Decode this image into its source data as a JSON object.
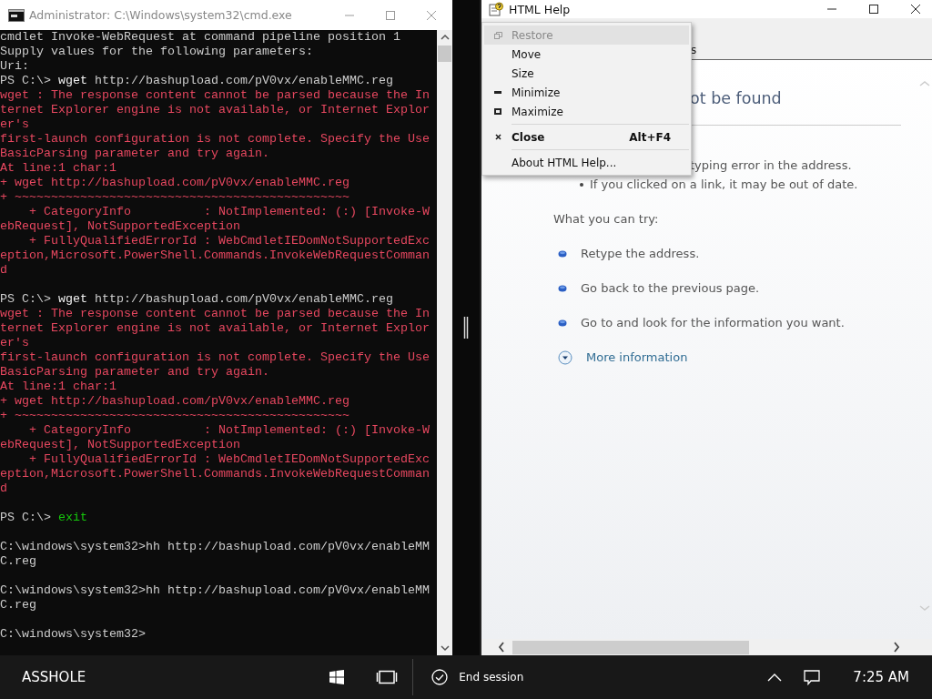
{
  "console_window": {
    "title": "Administrator: C:\\Windows\\system32\\cmd.exe",
    "lines": [
      {
        "kind": "text",
        "segments": [
          {
            "kind": "output",
            "text": "cmdlet Invoke-WebRequest at command pipeline position 1"
          }
        ]
      },
      {
        "kind": "text",
        "segments": [
          {
            "kind": "output",
            "text": "Supply values for the following parameters:"
          }
        ]
      },
      {
        "kind": "text",
        "segments": [
          {
            "kind": "output",
            "text": "Uri:"
          }
        ]
      },
      {
        "kind": "text",
        "segments": [
          {
            "kind": "output",
            "text": "PS C:\\> "
          },
          {
            "kind": "command",
            "text": "wget"
          },
          {
            "kind": "output",
            "text": " http://bashupload.com/pV0vx/enableMMC.reg"
          }
        ]
      },
      {
        "kind": "text",
        "segments": [
          {
            "kind": "error",
            "text": "wget : The response content cannot be parsed because the In"
          }
        ]
      },
      {
        "kind": "text",
        "segments": [
          {
            "kind": "error",
            "text": "ternet Explorer engine is not available, or Internet Explor"
          }
        ]
      },
      {
        "kind": "text",
        "segments": [
          {
            "kind": "error",
            "text": "er's"
          }
        ]
      },
      {
        "kind": "text",
        "segments": [
          {
            "kind": "error",
            "text": "first-launch configuration is not complete. Specify the Use"
          }
        ]
      },
      {
        "kind": "text",
        "segments": [
          {
            "kind": "error",
            "text": "BasicParsing parameter and try again."
          }
        ]
      },
      {
        "kind": "text",
        "segments": [
          {
            "kind": "error",
            "text": "At line:1 char:1"
          }
        ]
      },
      {
        "kind": "text",
        "segments": [
          {
            "kind": "error",
            "text": "+ wget http://bashupload.com/pV0vx/enableMMC.reg"
          }
        ]
      },
      {
        "kind": "text",
        "segments": [
          {
            "kind": "error",
            "text": "+ ~~~~~~~~~~~~~~~~~~~~~~~~~~~~~~~~~~~~~~~~~~~~~~"
          }
        ]
      },
      {
        "kind": "text",
        "segments": [
          {
            "kind": "error",
            "text": "    + CategoryInfo          : NotImplemented: (:) [Invoke-W"
          }
        ]
      },
      {
        "kind": "text",
        "segments": [
          {
            "kind": "error",
            "text": "ebRequest], NotSupportedException"
          }
        ]
      },
      {
        "kind": "text",
        "segments": [
          {
            "kind": "error",
            "text": "    + FullyQualifiedErrorId : WebCmdletIEDomNotSupportedExc"
          }
        ]
      },
      {
        "kind": "text",
        "segments": [
          {
            "kind": "error",
            "text": "eption,Microsoft.PowerShell.Commands.InvokeWebRequestComman"
          }
        ]
      },
      {
        "kind": "text",
        "segments": [
          {
            "kind": "error",
            "text": "d"
          }
        ]
      },
      {
        "kind": "blank"
      },
      {
        "kind": "text",
        "segments": [
          {
            "kind": "output",
            "text": "PS C:\\> "
          },
          {
            "kind": "command",
            "text": "wget"
          },
          {
            "kind": "output",
            "text": " http://bashupload.com/pV0vx/enableMMC.reg"
          }
        ]
      },
      {
        "kind": "text",
        "segments": [
          {
            "kind": "error",
            "text": "wget : The response content cannot be parsed because the In"
          }
        ]
      },
      {
        "kind": "text",
        "segments": [
          {
            "kind": "error",
            "text": "ternet Explorer engine is not available, or Internet Explor"
          }
        ]
      },
      {
        "kind": "text",
        "segments": [
          {
            "kind": "error",
            "text": "er's"
          }
        ]
      },
      {
        "kind": "text",
        "segments": [
          {
            "kind": "error",
            "text": "first-launch configuration is not complete. Specify the Use"
          }
        ]
      },
      {
        "kind": "text",
        "segments": [
          {
            "kind": "error",
            "text": "BasicParsing parameter and try again."
          }
        ]
      },
      {
        "kind": "text",
        "segments": [
          {
            "kind": "error",
            "text": "At line:1 char:1"
          }
        ]
      },
      {
        "kind": "text",
        "segments": [
          {
            "kind": "error",
            "text": "+ wget http://bashupload.com/pV0vx/enableMMC.reg"
          }
        ]
      },
      {
        "kind": "text",
        "segments": [
          {
            "kind": "error",
            "text": "+ ~~~~~~~~~~~~~~~~~~~~~~~~~~~~~~~~~~~~~~~~~~~~~~"
          }
        ]
      },
      {
        "kind": "text",
        "segments": [
          {
            "kind": "error",
            "text": "    + CategoryInfo          : NotImplemented: (:) [Invoke-W"
          }
        ]
      },
      {
        "kind": "text",
        "segments": [
          {
            "kind": "error",
            "text": "ebRequest], NotSupportedException"
          }
        ]
      },
      {
        "kind": "text",
        "segments": [
          {
            "kind": "error",
            "text": "    + FullyQualifiedErrorId : WebCmdletIEDomNotSupportedExc"
          }
        ]
      },
      {
        "kind": "text",
        "segments": [
          {
            "kind": "error",
            "text": "eption,Microsoft.PowerShell.Commands.InvokeWebRequestComman"
          }
        ]
      },
      {
        "kind": "text",
        "segments": [
          {
            "kind": "error",
            "text": "d"
          }
        ]
      },
      {
        "kind": "blank"
      },
      {
        "kind": "text",
        "segments": [
          {
            "kind": "output",
            "text": "PS C:\\> "
          },
          {
            "kind": "keyword",
            "text": "exit"
          }
        ]
      },
      {
        "kind": "blank"
      },
      {
        "kind": "text",
        "segments": [
          {
            "kind": "output",
            "text": "C:\\windows\\system32>hh http://bashupload.com/pV0vx/enableMM"
          }
        ]
      },
      {
        "kind": "text",
        "segments": [
          {
            "kind": "output",
            "text": "C.reg"
          }
        ]
      },
      {
        "kind": "blank"
      },
      {
        "kind": "text",
        "segments": [
          {
            "kind": "output",
            "text": "C:\\windows\\system32>hh http://bashupload.com/pV0vx/enableMM"
          }
        ]
      },
      {
        "kind": "text",
        "segments": [
          {
            "kind": "output",
            "text": "C.reg"
          }
        ]
      },
      {
        "kind": "blank"
      },
      {
        "kind": "text",
        "segments": [
          {
            "kind": "output",
            "text": "C:\\windows\\system32>"
          }
        ]
      }
    ]
  },
  "help_window": {
    "title": "HTML Help",
    "tab": "s",
    "heading": "ot be found",
    "reasons": [
      {
        "kind": "partial",
        "text": "typing error in the address."
      },
      {
        "kind": "bullet",
        "text": "If you clicked on a link, it may be out of date."
      }
    ],
    "try_heading": "What you can try:",
    "tries": [
      "Retype the address.",
      "Go back to the previous page.",
      "Go to  and look for the information you want."
    ],
    "more_info": "More information"
  },
  "system_menu": [
    {
      "kind": "restore",
      "label": "Restore",
      "selected": true,
      "disabled": true,
      "default": false
    },
    {
      "kind": "item",
      "label": "Move",
      "selected": false,
      "disabled": false,
      "default": false
    },
    {
      "kind": "item",
      "label": "Size",
      "selected": false,
      "disabled": false,
      "default": false
    },
    {
      "kind": "minimize",
      "label": "Minimize",
      "selected": false,
      "disabled": false,
      "default": false
    },
    {
      "kind": "maximize",
      "label": "Maximize",
      "selected": false,
      "disabled": false,
      "default": false
    },
    {
      "kind": "separator"
    },
    {
      "kind": "close",
      "label": "Close",
      "shortcut": "Alt+F4",
      "selected": false,
      "disabled": false,
      "default": true
    },
    {
      "kind": "separator"
    },
    {
      "kind": "item",
      "label": "About HTML Help...",
      "selected": false,
      "disabled": false,
      "default": false
    }
  ],
  "taskbar": {
    "user": "ASSHOLE",
    "end_session": "End session",
    "time": "7:25 AM"
  }
}
